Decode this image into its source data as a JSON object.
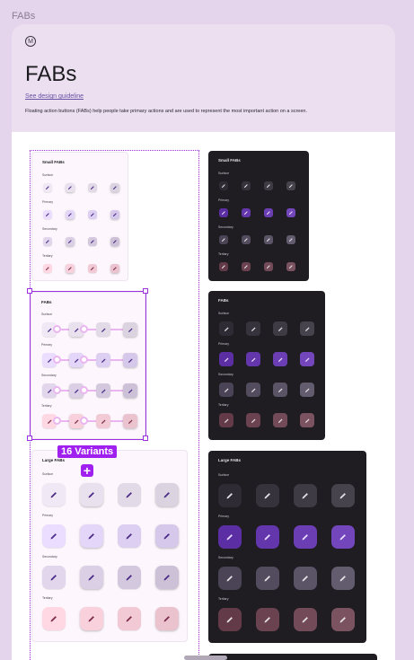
{
  "breadcrumb": "FABs",
  "header": {
    "title": "FABs",
    "guideline_link": "See design guideline",
    "description": "Floating action buttons (FABs) help people take primary actions and are used to represent the most important action on a screen."
  },
  "selection": {
    "variants_label": "16 Variants",
    "add_icon": "plus-icon"
  },
  "row_labels": [
    "Surface",
    "Primary",
    "Secondary",
    "Tertiary"
  ],
  "cards": {
    "small_light": {
      "title": "Small FABs"
    },
    "small_dark": {
      "title": "Small FABs"
    },
    "fabs_light": {
      "title": "FABs"
    },
    "fabs_dark": {
      "title": "FABs"
    },
    "large_light": {
      "title": "Large FABs"
    },
    "large_dark": {
      "title": "Large FABs"
    }
  },
  "colors": {
    "light": {
      "Surface": "#f1e8f5",
      "Primary": "#eaddff",
      "Secondary": "#e1d6ec",
      "Tertiary": "#ffd8e4"
    },
    "dark": {
      "Surface": "#2f2b35",
      "Primary": "#5b2fa3",
      "Secondary": "#4a4456",
      "Tertiary": "#633b48"
    },
    "accent": "#9b30e0"
  },
  "fab_icon": "edit-pencil-icon"
}
